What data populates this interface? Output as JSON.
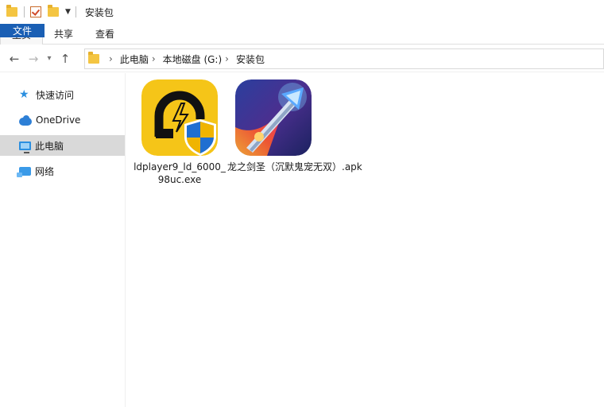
{
  "window": {
    "title": "安装包"
  },
  "ribbon": {
    "tabs": [
      "文件",
      "主页",
      "共享",
      "查看"
    ]
  },
  "address": {
    "crumbs": [
      "此电脑",
      "本地磁盘 (G:)",
      "安装包"
    ]
  },
  "sidebar": {
    "items": [
      {
        "label": "快速访问",
        "icon": "star-icon"
      },
      {
        "label": "OneDrive",
        "icon": "cloud-icon"
      },
      {
        "label": "此电脑",
        "icon": "computer-icon",
        "selected": true
      },
      {
        "label": "网络",
        "icon": "network-icon"
      }
    ]
  },
  "files": [
    {
      "name": "ldplayer9_ld_6000_98uc.exe",
      "icon": "ldplayer-icon"
    },
    {
      "name": "龙之剑圣（沉默鬼宠无双）.apk",
      "icon": "game-app-icon"
    }
  ],
  "colors": {
    "file_tab": "#1a5fb4",
    "selection": "#d9d9d9",
    "ldplayer_bg": "#f5c518"
  }
}
